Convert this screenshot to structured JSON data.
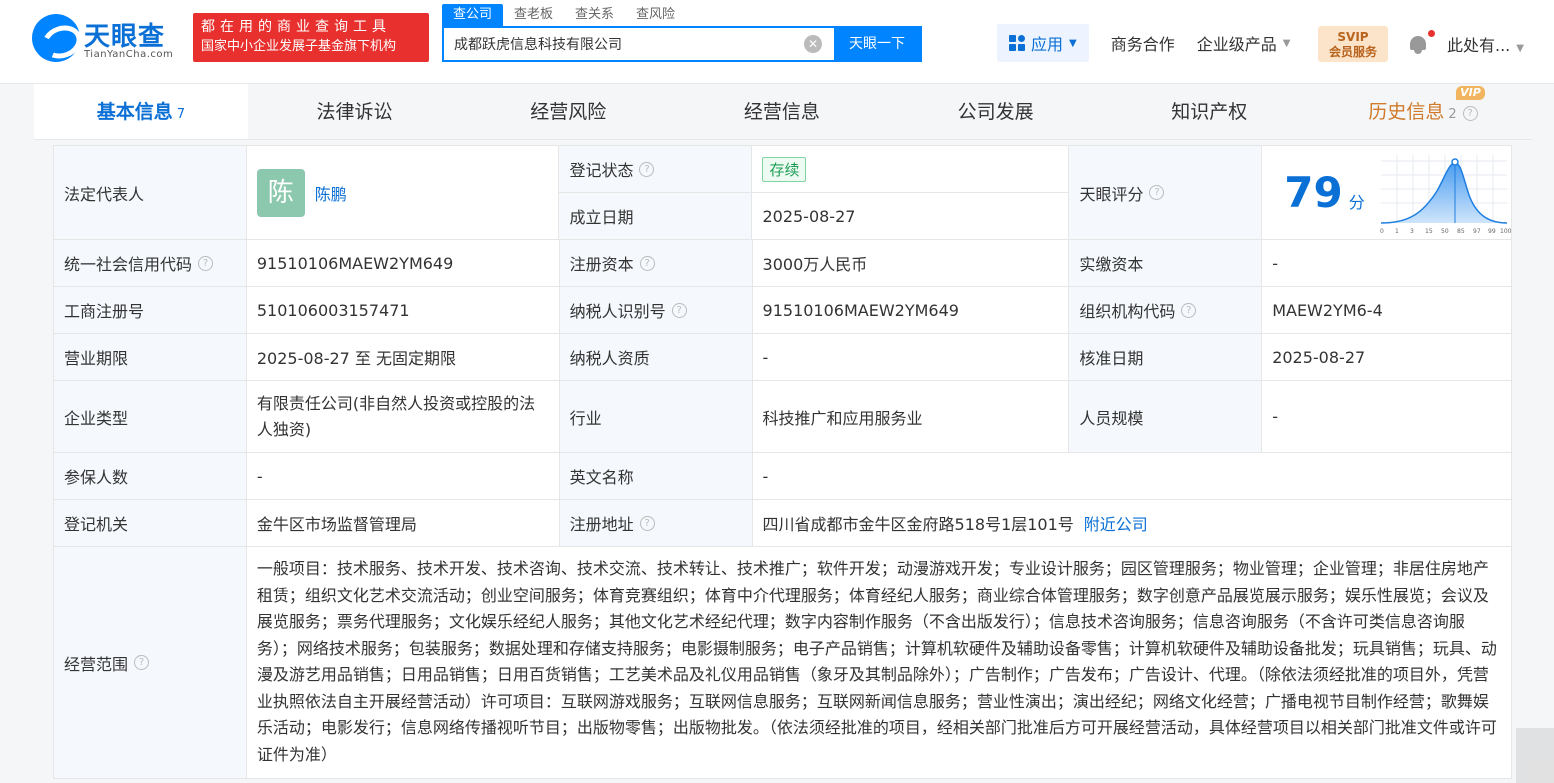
{
  "header": {
    "logo_text": "天眼查",
    "logo_sub": "TianYanCha.com",
    "slogan_line1": "都在用的商业查询工具",
    "slogan_line2": "国家中小企业发展子基金旗下机构",
    "search_tabs": [
      "查公司",
      "查老板",
      "查关系",
      "查风险"
    ],
    "search_value": "成都跃虎信息科技有限公司",
    "search_button": "天眼一下",
    "nav": {
      "app": "应用",
      "business": "商务合作",
      "enterprise": "企业级产品"
    },
    "svip_line1": "SVIP",
    "svip_line2": "会员服务",
    "user": "此处有..."
  },
  "tabs": [
    {
      "label": "基本信息",
      "count": "7"
    },
    {
      "label": "法律诉讼"
    },
    {
      "label": "经营风险"
    },
    {
      "label": "经营信息"
    },
    {
      "label": "公司发展"
    },
    {
      "label": "知识产权"
    },
    {
      "label": "历史信息",
      "count": "2",
      "badge": "VIP"
    }
  ],
  "info": {
    "legal_rep_label": "法定代表人",
    "legal_rep_avatar": "陈",
    "legal_rep_name": "陈鹏",
    "reg_status_label": "登记状态",
    "reg_status_value": "存续",
    "found_date_label": "成立日期",
    "found_date_value": "2025-08-27",
    "score_label": "天眼评分",
    "score_value": "79",
    "score_unit": "分",
    "score_axis": [
      "0",
      "1",
      "3",
      "15",
      "50",
      "85",
      "97",
      "99",
      "100"
    ],
    "credit_code_label": "统一社会信用代码",
    "credit_code_value": "91510106MAEW2YM649",
    "reg_capital_label": "注册资本",
    "reg_capital_value": "3000万人民币",
    "paid_capital_label": "实缴资本",
    "paid_capital_value": "-",
    "biz_reg_no_label": "工商注册号",
    "biz_reg_no_value": "510106003157471",
    "taxpayer_id_label": "纳税人识别号",
    "taxpayer_id_value": "91510106MAEW2YM649",
    "org_code_label": "组织机构代码",
    "org_code_value": "MAEW2YM6-4",
    "term_label": "营业期限",
    "term_value": "2025-08-27 至 无固定期限",
    "taxpayer_qual_label": "纳税人资质",
    "taxpayer_qual_value": "-",
    "approve_date_label": "核准日期",
    "approve_date_value": "2025-08-27",
    "company_type_label": "企业类型",
    "company_type_value": "有限责任公司(非自然人投资或控股的法人独资)",
    "industry_label": "行业",
    "industry_value": "科技推广和应用服务业",
    "staff_size_label": "人员规模",
    "staff_size_value": "-",
    "insured_label": "参保人数",
    "insured_value": "-",
    "english_name_label": "英文名称",
    "english_name_value": "-",
    "reg_authority_label": "登记机关",
    "reg_authority_value": "金牛区市场监督管理局",
    "address_label": "注册地址",
    "address_value": "四川省成都市金牛区金府路518号1层101号",
    "nearby_link": "附近公司",
    "scope_label": "经营范围",
    "scope_value": "一般项目：技术服务、技术开发、技术咨询、技术交流、技术转让、技术推广；软件开发；动漫游戏开发；专业设计服务；园区管理服务；物业管理；企业管理；非居住房地产租赁；组织文化艺术交流活动；创业空间服务；体育竞赛组织；体育中介代理服务；体育经纪人服务；商业综合体管理服务；数字创意产品展览展示服务；娱乐性展览；会议及展览服务；票务代理服务；文化娱乐经纪人服务；其他文化艺术经纪代理；数字内容制作服务（不含出版发行）；信息技术咨询服务；信息咨询服务（不含许可类信息咨询服务）；网络技术服务；包装服务；数据处理和存储支持服务；电影摄制服务；电子产品销售；计算机软硬件及辅助设备零售；计算机软硬件及辅助设备批发；玩具销售；玩具、动漫及游艺用品销售；日用品销售；日用百货销售；工艺美术品及礼仪用品销售（象牙及其制品除外）；广告制作；广告发布；广告设计、代理。（除依法须经批准的项目外，凭营业执照依法自主开展经营活动）许可项目：互联网游戏服务；互联网信息服务；互联网新闻信息服务；营业性演出；演出经纪；网络文化经营；广播电视节目制作经营；歌舞娱乐活动；电影发行；信息网络传播视听节目；出版物零售；出版物批发。（依法须经批准的项目，经相关部门批准后方可开展经营活动，具体经营项目以相关部门批准文件或许可证件为准）"
  }
}
